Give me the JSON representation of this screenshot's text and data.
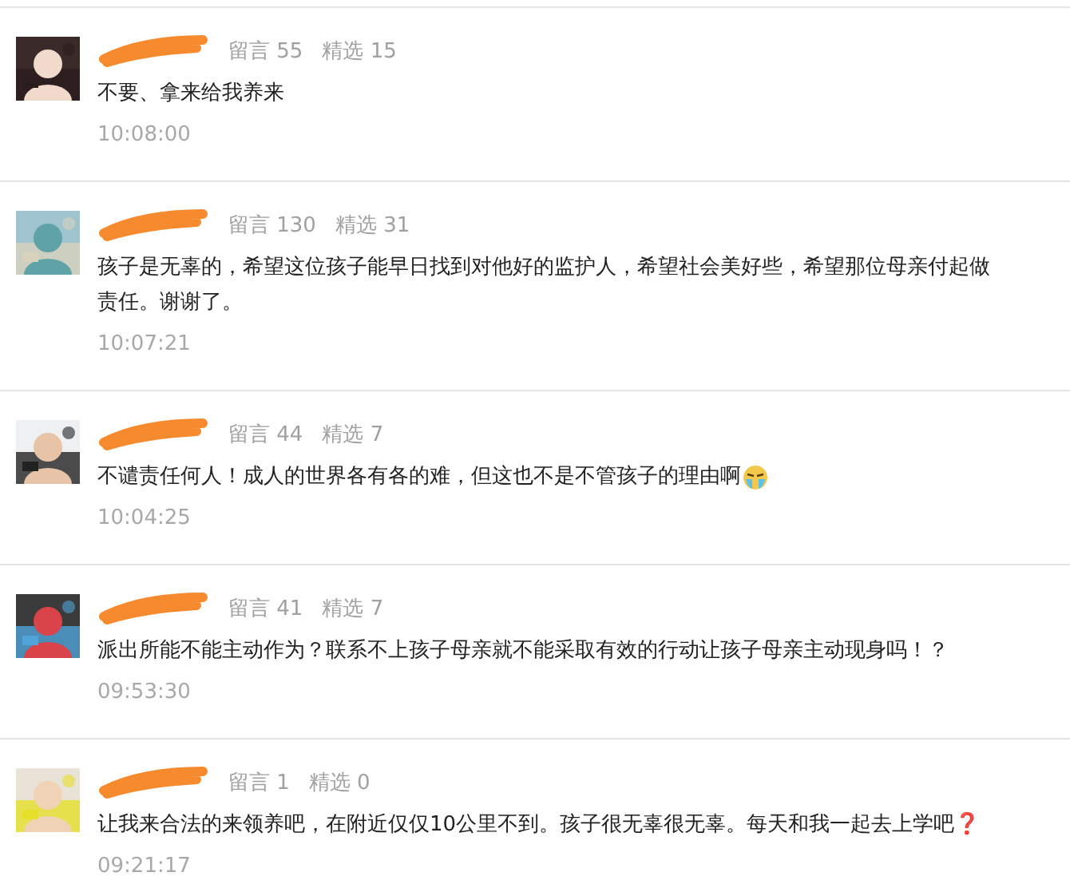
{
  "comments": [
    {
      "leaves_label": "留言 55",
      "picks_label": "精选 15",
      "lines": [
        "不要、拿来给我养来"
      ],
      "emoji": false,
      "time": "10:08:00"
    },
    {
      "leaves_label": "留言 130",
      "picks_label": "精选 31",
      "lines": [
        "孩子是无辜的，希望这位孩子能早日找到对他好的监护人，希望社会美好些，希望那位母亲付起做",
        "责任。谢谢了。"
      ],
      "emoji": false,
      "time": "10:07:21"
    },
    {
      "leaves_label": "留言 44",
      "picks_label": "精选 7",
      "lines": [
        "不谴责任何人！成人的世界各有各的难，但这也不是不管孩子的理由啊"
      ],
      "emoji": true,
      "time": "10:04:25"
    },
    {
      "leaves_label": "留言 41",
      "picks_label": "精选 7",
      "lines": [
        "派出所能不能主动作为？联系不上孩子母亲就不能采取有效的行动让孩子母亲主动现身吗！？"
      ],
      "emoji": false,
      "time": "09:53:30"
    },
    {
      "leaves_label": "留言 1",
      "picks_label": "精选 0",
      "lines": [
        "让我来合法的来领养吧，在附近仅仅10公里不到。孩子很无辜很无辜。每天和我一起去上学吧❓"
      ],
      "emoji": false,
      "time": "09:21:17"
    }
  ]
}
